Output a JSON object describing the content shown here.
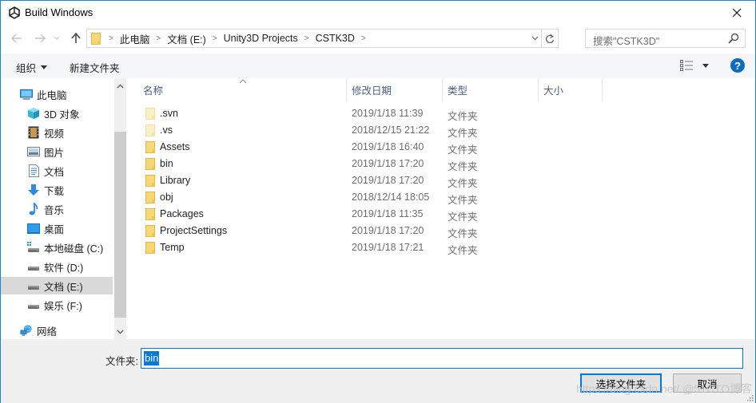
{
  "window": {
    "title": "Build Windows",
    "app_icon": "unity-icon"
  },
  "nav": {
    "back_icon": "arrow-left-icon",
    "forward_icon": "arrow-right-icon",
    "recent_icon": "chevron-down-icon",
    "up_icon": "arrow-up-icon",
    "breadcrumbs": [
      "此电脑",
      "文档 (E:)",
      "Unity3D Projects",
      "CSTK3D"
    ],
    "search_placeholder": "搜索\"CSTK3D\""
  },
  "toolbar": {
    "organize_label": "组织",
    "new_folder_label": "新建文件夹",
    "help_label": "?"
  },
  "sidebar": {
    "items": [
      {
        "label": "此电脑",
        "icon": "computer-icon",
        "level": 0
      },
      {
        "label": "3D 对象",
        "icon": "cube-3d-icon",
        "level": 1
      },
      {
        "label": "视频",
        "icon": "video-icon",
        "level": 1
      },
      {
        "label": "图片",
        "icon": "picture-icon",
        "level": 1
      },
      {
        "label": "文档",
        "icon": "document-icon",
        "level": 1
      },
      {
        "label": "下载",
        "icon": "download-icon",
        "level": 1
      },
      {
        "label": "音乐",
        "icon": "music-icon",
        "level": 1
      },
      {
        "label": "桌面",
        "icon": "desktop-icon",
        "level": 1
      },
      {
        "label": "本地磁盘 (C:)",
        "icon": "system-drive-icon",
        "level": 1
      },
      {
        "label": "软件 (D:)",
        "icon": "drive-icon",
        "level": 1
      },
      {
        "label": "文档 (E:)",
        "icon": "drive-icon",
        "level": 1,
        "selected": true
      },
      {
        "label": "娱乐 (F:)",
        "icon": "drive-icon",
        "level": 1
      },
      {
        "label": "网络",
        "icon": "network-icon",
        "level": 0
      }
    ]
  },
  "filelist": {
    "columns": [
      "名称",
      "修改日期",
      "类型",
      "大小"
    ],
    "sort_column": "名称",
    "rows": [
      {
        "name": ".svn",
        "date": "2019/1/18 11:39",
        "type": "文件夹",
        "size": "",
        "hidden": true
      },
      {
        "name": ".vs",
        "date": "2018/12/15 21:22",
        "type": "文件夹",
        "size": "",
        "hidden": true
      },
      {
        "name": "Assets",
        "date": "2019/1/18 16:40",
        "type": "文件夹",
        "size": ""
      },
      {
        "name": "bin",
        "date": "2019/1/18 17:20",
        "type": "文件夹",
        "size": ""
      },
      {
        "name": "Library",
        "date": "2019/1/18 17:20",
        "type": "文件夹",
        "size": ""
      },
      {
        "name": "obj",
        "date": "2018/12/14 18:05",
        "type": "文件夹",
        "size": ""
      },
      {
        "name": "Packages",
        "date": "2019/1/18 11:35",
        "type": "文件夹",
        "size": ""
      },
      {
        "name": "ProjectSettings",
        "date": "2019/1/18 17:20",
        "type": "文件夹",
        "size": ""
      },
      {
        "name": "Temp",
        "date": "2019/1/18 17:21",
        "type": "文件夹",
        "size": ""
      }
    ]
  },
  "bottom": {
    "folder_label": "文件夹:",
    "folder_value": "bin",
    "select_button": "选择文件夹",
    "cancel_button": "取消",
    "watermark": "https://blog.csdn.net/ @51CTO博客"
  },
  "colors": {
    "accent": "#0078d7",
    "window_border": "#1883d7",
    "folder_yellow": "#f8d775",
    "help_blue": "#0f6cbd"
  }
}
